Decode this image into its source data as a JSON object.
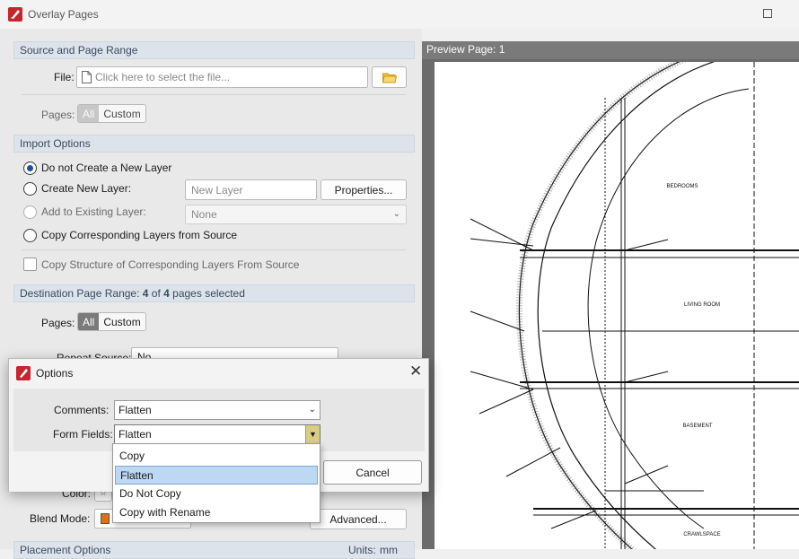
{
  "window": {
    "title": "Overlay Pages"
  },
  "source": {
    "header": "Source and Page Range",
    "file_label": "File:",
    "file_placeholder": "Click here to select the file...",
    "pages_label": "Pages:",
    "pages_all": "All",
    "pages_custom": "Custom"
  },
  "import": {
    "header": "Import Options",
    "opt_no_layer": "Do not Create a New Layer",
    "opt_new_layer": "Create New Layer:",
    "new_layer_placeholder": "New Layer",
    "properties_button": "Properties...",
    "opt_existing_layer": "Add to Existing Layer:",
    "existing_layer_value": "None",
    "opt_copy_layers": "Copy Corresponding Layers from Source",
    "copy_structure": "Copy Structure of Corresponding Layers From Source"
  },
  "destination": {
    "header_prefix": "Destination Page Range: ",
    "selected": "4",
    "of": " of ",
    "total": "4",
    "header_suffix": " pages selected",
    "pages_label": "Pages:",
    "pages_all": "All",
    "pages_custom": "Custom",
    "repeat_label": "Repeat Source:",
    "repeat_value": "No"
  },
  "appearance": {
    "color_label": "Color:",
    "blend_label": "Blend Mode:",
    "advanced_button": "Advanced...",
    "placement_header": "Placement Options",
    "units_label": "Units:",
    "units_value": "mm"
  },
  "preview": {
    "header": "Preview Page: 1",
    "labels": {
      "bedrooms": "BEDROOMS",
      "living_room": "LIVING ROOM",
      "basement": "BASEMENT",
      "crawlspace": "CRAWLSPACE"
    }
  },
  "options_dialog": {
    "title": "Options",
    "comments_label": "Comments:",
    "comments_value": "Flatten",
    "form_fields_label": "Form Fields:",
    "form_fields_value": "Flatten",
    "cancel_button": "Cancel",
    "dropdown_items": [
      "Copy",
      "Flatten",
      "Do Not Copy",
      "Copy with Rename"
    ],
    "dropdown_selected_index": 1
  },
  "colors": {
    "accent": "#1c4f9e",
    "selection": "#bcd8f3",
    "logo": "#c4262e"
  }
}
